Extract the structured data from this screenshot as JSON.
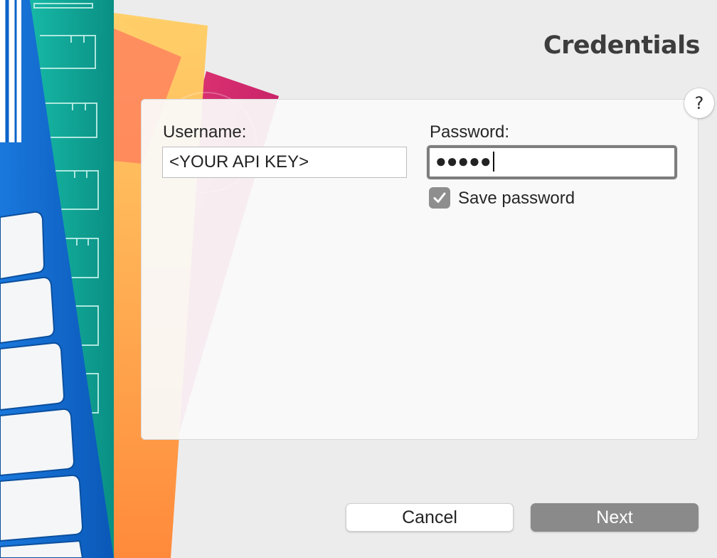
{
  "window": {
    "title": "Credentials"
  },
  "form": {
    "username": {
      "label": "Username:",
      "value": "<YOUR API KEY>"
    },
    "password": {
      "label": "Password:",
      "value": "●●●●●"
    },
    "save_password": {
      "label": "Save password",
      "checked": true
    }
  },
  "help": {
    "label": "?"
  },
  "buttons": {
    "cancel": "Cancel",
    "next": "Next"
  },
  "colors": {
    "background": "#ececec",
    "primary_button": "#8a8a8a",
    "checkbox": "#8e8e8e",
    "book_blue": "#0a63c9",
    "book_teal": "#1cb5a3",
    "book_orange": "#ffb35a",
    "book_pink": "#e8347a"
  },
  "decoration": {
    "left_art": "stack-of-colored-books-icon"
  }
}
